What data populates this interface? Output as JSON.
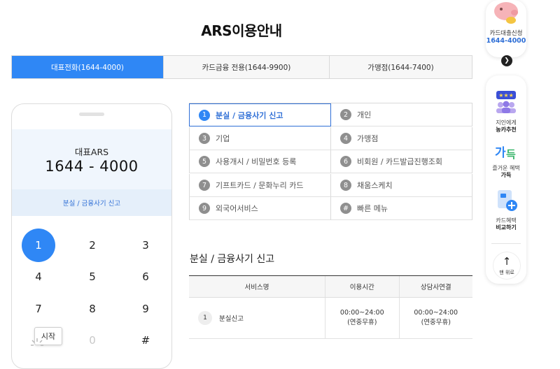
{
  "page": {
    "title": "ARS이용안내"
  },
  "tabs": [
    {
      "label": "대표전화(1644-4000)",
      "active": true
    },
    {
      "label": "카드금융 전용(1644-9900)",
      "active": false
    },
    {
      "label": "가맹점(1644-7400)",
      "active": false
    }
  ],
  "phone": {
    "label": "대표ARS",
    "number": "1644 - 4000",
    "sub": "분실 / 금융사기 신고",
    "keys": [
      "1",
      "2",
      "3",
      "4",
      "5",
      "6",
      "7",
      "8",
      "9",
      "*",
      "0",
      "#"
    ],
    "tooltip": "시작"
  },
  "menu": [
    {
      "num": "1",
      "label": "분실 / 금융사기 신고",
      "active": true
    },
    {
      "num": "2",
      "label": "개인"
    },
    {
      "num": "3",
      "label": "기업"
    },
    {
      "num": "4",
      "label": "가맹점"
    },
    {
      "num": "5",
      "label": "사용개시 / 비밀번호 등록"
    },
    {
      "num": "6",
      "label": "비회원 / 카드발급진행조회"
    },
    {
      "num": "7",
      "label": "기프트카드 / 문화누리 카드"
    },
    {
      "num": "8",
      "label": "채움스케치"
    },
    {
      "num": "9",
      "label": "외국어서비스"
    },
    {
      "num": "#",
      "label": "빠른 메뉴"
    }
  ],
  "section": {
    "title": "분실 / 금융사기 신고"
  },
  "table": {
    "headers": [
      "서비스명",
      "이용시간",
      "상담사연결"
    ],
    "rows": [
      {
        "num": "1",
        "service": "분실신고",
        "hours": "00:00~24:00",
        "hours_note": "(연중무휴)",
        "agent": "00:00~24:00",
        "agent_note": "(연중무휴)"
      }
    ]
  },
  "side": {
    "loan_title": "카드대출신청",
    "loan_number": "1644-4000",
    "items": [
      {
        "line1": "지인에게",
        "line2": "농카추천"
      },
      {
        "line1": "즐거운 혜택",
        "line2": "가득"
      },
      {
        "line1": "카드혜택",
        "line2": "비교하기"
      }
    ],
    "top_label": "맨 위로"
  },
  "colors": {
    "accent": "#2f87f5",
    "accent_text": "#2f6fd6"
  }
}
